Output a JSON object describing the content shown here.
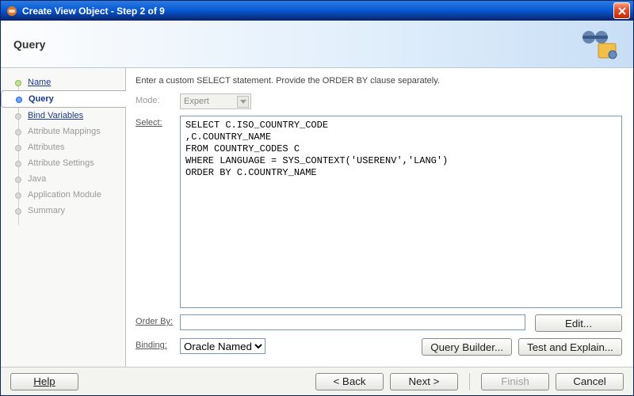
{
  "window": {
    "title": "Create View Object - Step 2 of 9"
  },
  "banner": {
    "heading": "Query"
  },
  "steps": [
    {
      "label": "Name",
      "state": "done"
    },
    {
      "label": "Query",
      "state": "current"
    },
    {
      "label": "Bind Variables",
      "state": "link"
    },
    {
      "label": "Attribute Mappings",
      "state": "future"
    },
    {
      "label": "Attributes",
      "state": "future"
    },
    {
      "label": "Attribute Settings",
      "state": "future"
    },
    {
      "label": "Java",
      "state": "future"
    },
    {
      "label": "Application Module",
      "state": "future"
    },
    {
      "label": "Summary",
      "state": "future"
    }
  ],
  "main": {
    "instruction": "Enter a custom SELECT statement. Provide the ORDER BY clause separately.",
    "mode_label": "Mode:",
    "mode_value": "Expert",
    "select_label": "Select:",
    "select_value": "SELECT C.ISO_COUNTRY_CODE\n,C.COUNTRY_NAME\nFROM COUNTRY_CODES C\nWHERE LANGUAGE = SYS_CONTEXT('USERENV','LANG')\nORDER BY C.COUNTRY_NAME",
    "orderby_label": "Order By:",
    "orderby_value": "",
    "binding_label": "Binding:",
    "binding_value": "Oracle Named",
    "edit_btn": "Edit...",
    "query_builder_btn": "Query Builder...",
    "test_explain_btn": "Test and Explain..."
  },
  "footer": {
    "help": "Help",
    "back": "< Back",
    "next": "Next >",
    "finish": "Finish",
    "cancel": "Cancel"
  }
}
